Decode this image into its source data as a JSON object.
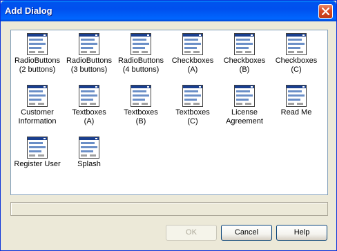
{
  "window": {
    "title": "Add Dialog",
    "close_label": "×"
  },
  "dialog_types": [
    {
      "label": "RadioButtons\n(2 buttons)",
      "icon": "dialog-icon"
    },
    {
      "label": "RadioButtons\n(3 buttons)",
      "icon": "dialog-icon"
    },
    {
      "label": "RadioButtons\n(4 buttons)",
      "icon": "dialog-icon"
    },
    {
      "label": "Checkboxes\n(A)",
      "icon": "dialog-icon"
    },
    {
      "label": "Checkboxes\n(B)",
      "icon": "dialog-icon"
    },
    {
      "label": "Checkboxes\n(C)",
      "icon": "dialog-icon"
    },
    {
      "label": "Customer\nInformation",
      "icon": "dialog-icon"
    },
    {
      "label": "Textboxes\n(A)",
      "icon": "dialog-icon"
    },
    {
      "label": "Textboxes\n(B)",
      "icon": "dialog-icon"
    },
    {
      "label": "Textboxes\n(C)",
      "icon": "dialog-icon"
    },
    {
      "label": "License\nAgreement",
      "icon": "dialog-icon"
    },
    {
      "label": "Read Me",
      "icon": "dialog-icon"
    },
    {
      "label": "Register User",
      "icon": "dialog-icon"
    },
    {
      "label": "Splash",
      "icon": "dialog-icon"
    }
  ],
  "status": {
    "text": ""
  },
  "buttons": {
    "ok": "OK",
    "cancel": "Cancel",
    "help": "Help"
  },
  "colors": {
    "titlebar": "#0053ee",
    "window_bg": "#ece9d8",
    "close": "#d84a23"
  }
}
